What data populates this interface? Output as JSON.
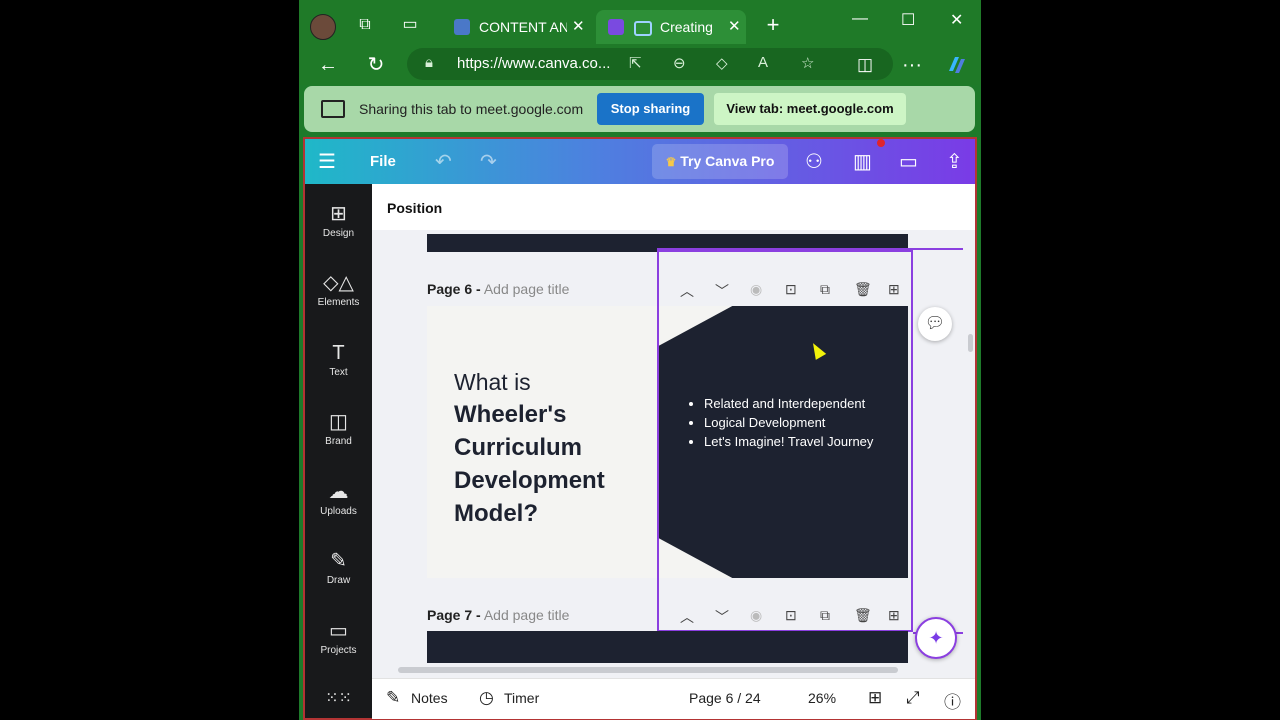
{
  "browser": {
    "tabs": [
      {
        "label": "CONTENT ANA",
        "active": false
      },
      {
        "label": "Creating a",
        "active": true
      }
    ],
    "url": "https://www.canva.co..."
  },
  "share_bar": {
    "message": "Sharing this tab to meet.google.com",
    "stop_label": "Stop sharing",
    "view_label": "View tab: meet.google.com"
  },
  "canva": {
    "file_label": "File",
    "try_pro_label": "Try Canva Pro",
    "position_label": "Position",
    "sidebar": [
      {
        "label": "Design",
        "icon": "design-icon"
      },
      {
        "label": "Elements",
        "icon": "elements-icon"
      },
      {
        "label": "Text",
        "icon": "text-icon"
      },
      {
        "label": "Brand",
        "icon": "brand-icon"
      },
      {
        "label": "Uploads",
        "icon": "uploads-icon"
      },
      {
        "label": "Draw",
        "icon": "draw-icon"
      },
      {
        "label": "Projects",
        "icon": "projects-icon"
      }
    ],
    "page6": {
      "label": "Page 6 -",
      "title_placeholder": "Add page title"
    },
    "page7": {
      "label": "Page 7 -",
      "title_placeholder": "Add page title"
    },
    "slide": {
      "heading_light": "What is",
      "heading_bold_1": "Wheeler's",
      "heading_bold_2": "Curriculum",
      "heading_bold_3": "Development",
      "heading_bold_4": "Model?",
      "bullets": [
        "Related and Interdependent",
        "Logical Development",
        "Let's Imagine! Travel Journey"
      ]
    },
    "bottom": {
      "notes_label": "Notes",
      "timer_label": "Timer",
      "page_indicator": "Page 6 / 24",
      "zoom": "26%"
    }
  }
}
